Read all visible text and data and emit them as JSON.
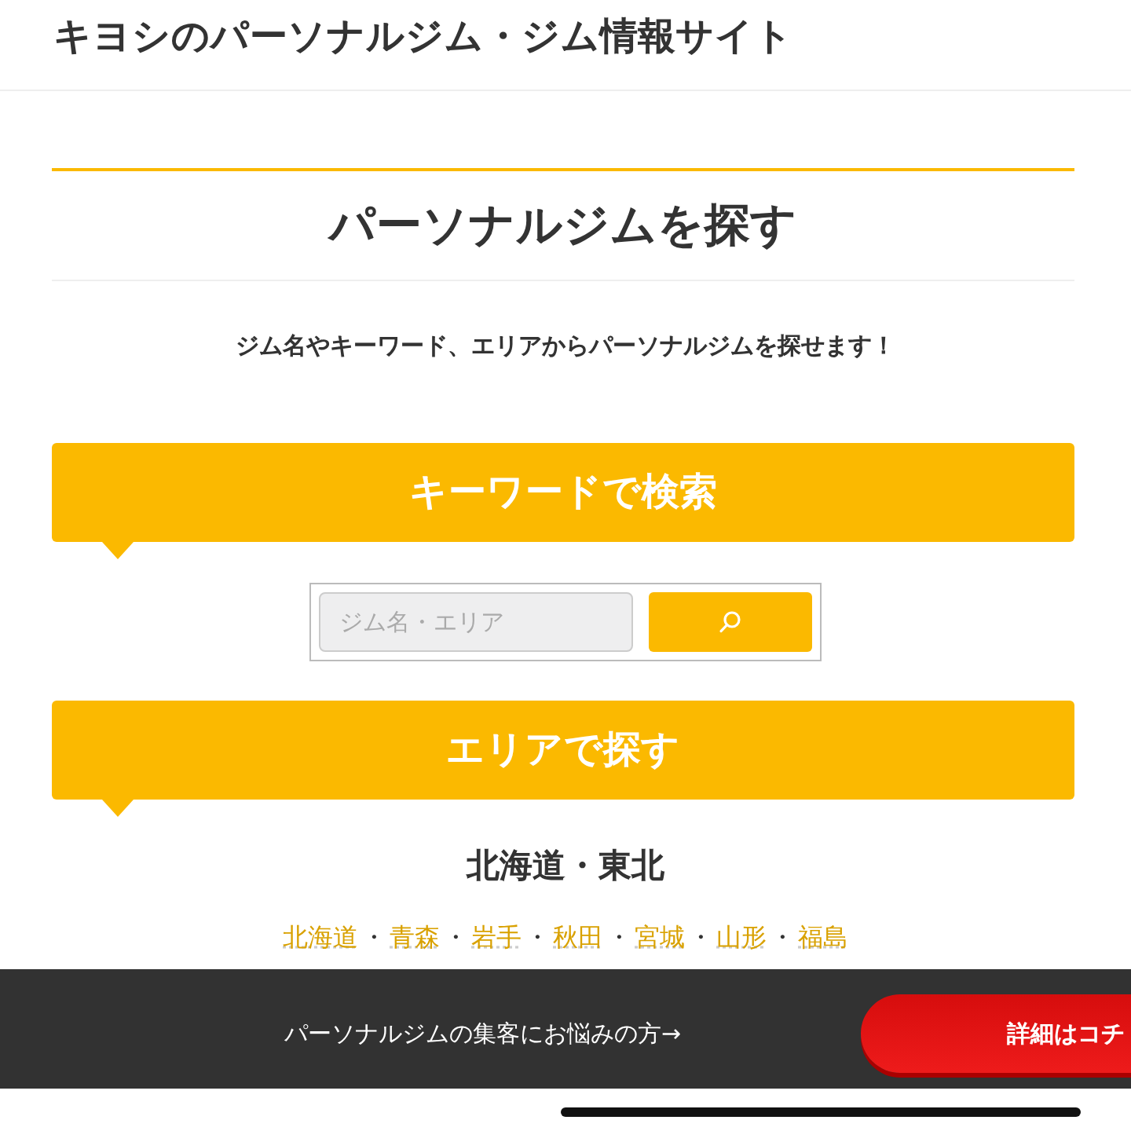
{
  "site_title": "キヨシのパーソナルジム・ジム情報サイト",
  "page_heading": "パーソナルジムを探す",
  "intro": "ジム名やキーワード、エリアからパーソナルジムを探せます！",
  "keyword_section": {
    "title": "キーワードで検索",
    "search": {
      "placeholder": "ジム名・エリア"
    }
  },
  "area_section": {
    "title": "エリアで探す",
    "separator": "・",
    "regions": [
      {
        "name": "北海道・東北",
        "prefectures": [
          "北海道",
          "青森",
          "岩手",
          "秋田",
          "宮城",
          "山形",
          "福島"
        ]
      }
    ]
  },
  "promo_banner": {
    "text": "パーソナルジムの集客にお悩みの方→",
    "button": "詳細はコチ"
  }
}
